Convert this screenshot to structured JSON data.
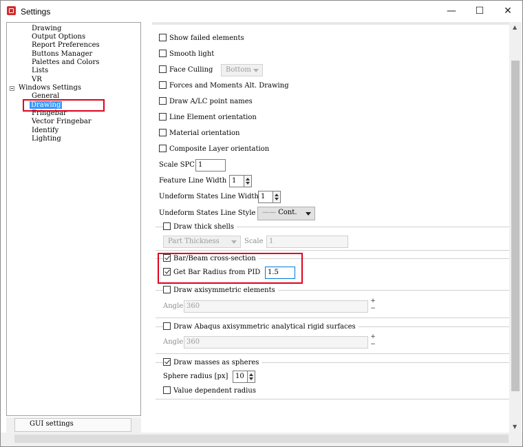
{
  "window": {
    "title": "Settings",
    "minimize_glyph": "—",
    "maximize_glyph": "☐",
    "close_glyph": "✕"
  },
  "tree": {
    "items": [
      {
        "label": "Drawing",
        "level": 2
      },
      {
        "label": "Output Options",
        "level": 2
      },
      {
        "label": "Report Preferences",
        "level": 2
      },
      {
        "label": "Buttons Manager",
        "level": 2
      },
      {
        "label": "Palettes and Colors",
        "level": 2
      },
      {
        "label": "Lists",
        "level": 2
      },
      {
        "label": "VR",
        "level": 2
      },
      {
        "label": "Windows Settings",
        "level": 1
      },
      {
        "label": "General",
        "level": 2
      },
      {
        "label": "Drawing",
        "level": 2,
        "selected": true
      },
      {
        "label": "Fringebar",
        "level": 2
      },
      {
        "label": "Vector Fringebar",
        "level": 2
      },
      {
        "label": "Identify",
        "level": 2
      },
      {
        "label": "Lighting",
        "level": 2
      }
    ]
  },
  "bottom_tab": {
    "label": "GUI settings"
  },
  "settings": {
    "show_failed_elements": {
      "label": "Show failed elements",
      "checked": false
    },
    "smooth_light": {
      "label": "Smooth light",
      "checked": false
    },
    "face_culling": {
      "label": "Face Culling",
      "checked": false,
      "option": "Bottom"
    },
    "forces_moments": {
      "label": "Forces and Moments Alt. Drawing",
      "checked": false
    },
    "draw_alc": {
      "label": "Draw A/LC point names",
      "checked": false
    },
    "line_element_orientation": {
      "label": "Line Element orientation",
      "checked": false
    },
    "material_orientation": {
      "label": "Material orientation",
      "checked": false
    },
    "composite_layer_orientation": {
      "label": "Composite Layer orientation",
      "checked": false
    },
    "scale_spc": {
      "label": "Scale SPC",
      "value": "1"
    },
    "feature_line_width": {
      "label": "Feature Line Width",
      "value": "1"
    },
    "undeform_line_width": {
      "label": "Undeform States Line Width",
      "value": "1"
    },
    "undeform_line_style": {
      "label": "Undeform States Line Style",
      "value": "Cont.",
      "swatch": "——"
    },
    "draw_thick_shells": {
      "label": "Draw thick shells",
      "checked": false,
      "combo": "Part Thickness",
      "scale_label": "Scale",
      "scale_value": "1"
    },
    "bar_beam_cross_section": {
      "label": "Bar/Beam cross-section",
      "checked": true
    },
    "get_bar_radius": {
      "label": "Get Bar Radius from PID",
      "checked": true,
      "value": "1.5"
    },
    "draw_axisymmetric": {
      "label": "Draw axisymmetric elements",
      "checked": false,
      "angle_label": "Angle",
      "angle_value": "360"
    },
    "draw_abaqus": {
      "label": "Draw Abaqus axisymmetric analytical rigid surfaces",
      "checked": false,
      "angle_label": "Angle",
      "angle_value": "360"
    },
    "draw_masses": {
      "label": "Draw masses as spheres",
      "checked": true
    },
    "sphere_radius": {
      "label": "Sphere radius [px]",
      "value": "10"
    },
    "value_dependent_radius": {
      "label": "Value dependent radius",
      "checked": false
    },
    "plus_glyph": "+",
    "minus_glyph": "−"
  },
  "colors": {
    "highlight": "#e0001b",
    "selection": "#3399ff"
  }
}
